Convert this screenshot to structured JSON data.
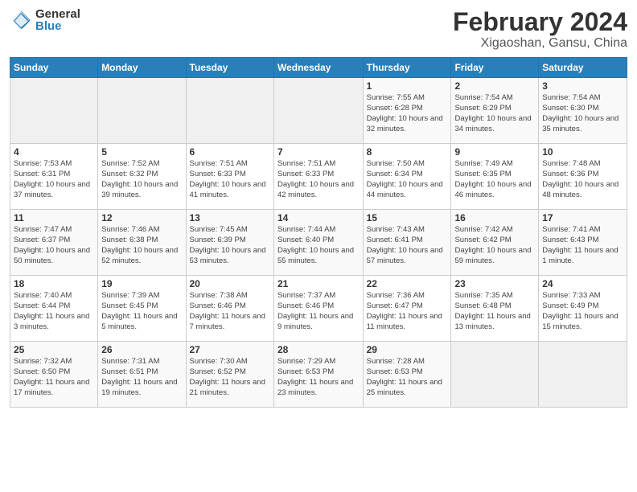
{
  "logo": {
    "general": "General",
    "blue": "Blue"
  },
  "header": {
    "title": "February 2024",
    "subtitle": "Xigaoshan, Gansu, China"
  },
  "weekdays": [
    "Sunday",
    "Monday",
    "Tuesday",
    "Wednesday",
    "Thursday",
    "Friday",
    "Saturday"
  ],
  "weeks": [
    [
      {
        "day": "",
        "info": ""
      },
      {
        "day": "",
        "info": ""
      },
      {
        "day": "",
        "info": ""
      },
      {
        "day": "",
        "info": ""
      },
      {
        "day": "1",
        "info": "Sunrise: 7:55 AM\nSunset: 6:28 PM\nDaylight: 10 hours and 32 minutes."
      },
      {
        "day": "2",
        "info": "Sunrise: 7:54 AM\nSunset: 6:29 PM\nDaylight: 10 hours and 34 minutes."
      },
      {
        "day": "3",
        "info": "Sunrise: 7:54 AM\nSunset: 6:30 PM\nDaylight: 10 hours and 35 minutes."
      }
    ],
    [
      {
        "day": "4",
        "info": "Sunrise: 7:53 AM\nSunset: 6:31 PM\nDaylight: 10 hours and 37 minutes."
      },
      {
        "day": "5",
        "info": "Sunrise: 7:52 AM\nSunset: 6:32 PM\nDaylight: 10 hours and 39 minutes."
      },
      {
        "day": "6",
        "info": "Sunrise: 7:51 AM\nSunset: 6:33 PM\nDaylight: 10 hours and 41 minutes."
      },
      {
        "day": "7",
        "info": "Sunrise: 7:51 AM\nSunset: 6:33 PM\nDaylight: 10 hours and 42 minutes."
      },
      {
        "day": "8",
        "info": "Sunrise: 7:50 AM\nSunset: 6:34 PM\nDaylight: 10 hours and 44 minutes."
      },
      {
        "day": "9",
        "info": "Sunrise: 7:49 AM\nSunset: 6:35 PM\nDaylight: 10 hours and 46 minutes."
      },
      {
        "day": "10",
        "info": "Sunrise: 7:48 AM\nSunset: 6:36 PM\nDaylight: 10 hours and 48 minutes."
      }
    ],
    [
      {
        "day": "11",
        "info": "Sunrise: 7:47 AM\nSunset: 6:37 PM\nDaylight: 10 hours and 50 minutes."
      },
      {
        "day": "12",
        "info": "Sunrise: 7:46 AM\nSunset: 6:38 PM\nDaylight: 10 hours and 52 minutes."
      },
      {
        "day": "13",
        "info": "Sunrise: 7:45 AM\nSunset: 6:39 PM\nDaylight: 10 hours and 53 minutes."
      },
      {
        "day": "14",
        "info": "Sunrise: 7:44 AM\nSunset: 6:40 PM\nDaylight: 10 hours and 55 minutes."
      },
      {
        "day": "15",
        "info": "Sunrise: 7:43 AM\nSunset: 6:41 PM\nDaylight: 10 hours and 57 minutes."
      },
      {
        "day": "16",
        "info": "Sunrise: 7:42 AM\nSunset: 6:42 PM\nDaylight: 10 hours and 59 minutes."
      },
      {
        "day": "17",
        "info": "Sunrise: 7:41 AM\nSunset: 6:43 PM\nDaylight: 11 hours and 1 minute."
      }
    ],
    [
      {
        "day": "18",
        "info": "Sunrise: 7:40 AM\nSunset: 6:44 PM\nDaylight: 11 hours and 3 minutes."
      },
      {
        "day": "19",
        "info": "Sunrise: 7:39 AM\nSunset: 6:45 PM\nDaylight: 11 hours and 5 minutes."
      },
      {
        "day": "20",
        "info": "Sunrise: 7:38 AM\nSunset: 6:46 PM\nDaylight: 11 hours and 7 minutes."
      },
      {
        "day": "21",
        "info": "Sunrise: 7:37 AM\nSunset: 6:46 PM\nDaylight: 11 hours and 9 minutes."
      },
      {
        "day": "22",
        "info": "Sunrise: 7:36 AM\nSunset: 6:47 PM\nDaylight: 11 hours and 11 minutes."
      },
      {
        "day": "23",
        "info": "Sunrise: 7:35 AM\nSunset: 6:48 PM\nDaylight: 11 hours and 13 minutes."
      },
      {
        "day": "24",
        "info": "Sunrise: 7:33 AM\nSunset: 6:49 PM\nDaylight: 11 hours and 15 minutes."
      }
    ],
    [
      {
        "day": "25",
        "info": "Sunrise: 7:32 AM\nSunset: 6:50 PM\nDaylight: 11 hours and 17 minutes."
      },
      {
        "day": "26",
        "info": "Sunrise: 7:31 AM\nSunset: 6:51 PM\nDaylight: 11 hours and 19 minutes."
      },
      {
        "day": "27",
        "info": "Sunrise: 7:30 AM\nSunset: 6:52 PM\nDaylight: 11 hours and 21 minutes."
      },
      {
        "day": "28",
        "info": "Sunrise: 7:29 AM\nSunset: 6:53 PM\nDaylight: 11 hours and 23 minutes."
      },
      {
        "day": "29",
        "info": "Sunrise: 7:28 AM\nSunset: 6:53 PM\nDaylight: 11 hours and 25 minutes."
      },
      {
        "day": "",
        "info": ""
      },
      {
        "day": "",
        "info": ""
      }
    ]
  ]
}
